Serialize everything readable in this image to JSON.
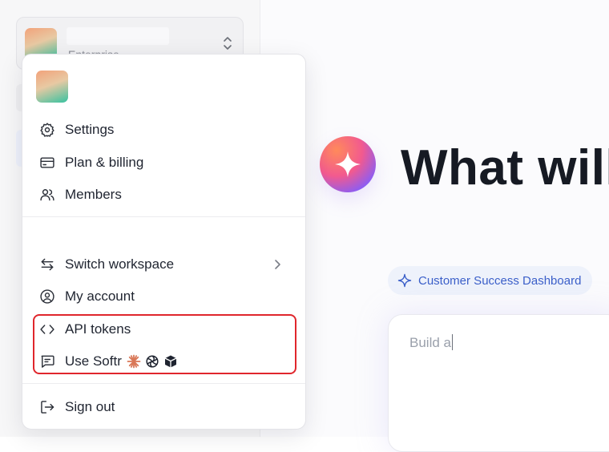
{
  "sidebar": {
    "workspace": {
      "plan": "Enterprise"
    }
  },
  "main": {
    "headline": "What will",
    "suggestion": "Customer Success Dashboard",
    "composer_text": "Build a"
  },
  "menu": {
    "top_items": [
      {
        "label": "Settings",
        "icon": "gear-icon"
      },
      {
        "label": "Plan & billing",
        "icon": "credit-card-icon"
      },
      {
        "label": "Members",
        "icon": "users-icon"
      }
    ],
    "middle_items": [
      {
        "label": "Switch workspace",
        "icon": "switch-arrows-icon"
      },
      {
        "label": "My account",
        "icon": "user-circle-icon"
      },
      {
        "label": "API tokens",
        "icon": "code-brackets-icon"
      },
      {
        "label": "Use Softr",
        "icon": "chat-icon"
      }
    ],
    "bottom_items": [
      {
        "label": "Sign out",
        "icon": "sign-out-icon"
      }
    ]
  },
  "colors": {
    "highlight": "#e0262c",
    "accent": "#3b5fc9"
  }
}
